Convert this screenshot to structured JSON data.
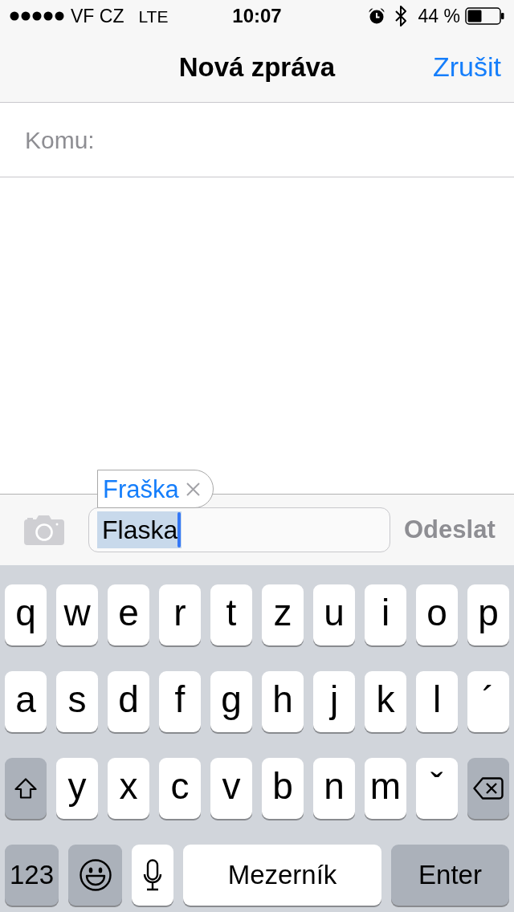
{
  "status_bar": {
    "carrier": "VF CZ",
    "network": "LTE",
    "time": "10:07",
    "battery": "44 %"
  },
  "nav_bar": {
    "title": "Nová zpráva",
    "cancel_button": "Zrušit"
  },
  "recipient": {
    "label": "Komu:"
  },
  "compose": {
    "text": "Flaska",
    "selected": true,
    "send_button": {
      "label": "Odeslat",
      "disabled": true
    },
    "suggestion": {
      "text": "Fraška"
    }
  },
  "keyboard": {
    "letter_rows": [
      [
        {
          "kind": "char",
          "label": "q"
        },
        {
          "kind": "char",
          "label": "w"
        },
        {
          "kind": "char",
          "label": "e"
        },
        {
          "kind": "char",
          "label": "r"
        },
        {
          "kind": "char",
          "label": "t"
        },
        {
          "kind": "char",
          "label": "z"
        },
        {
          "kind": "char",
          "label": "u"
        },
        {
          "kind": "char",
          "label": "i"
        },
        {
          "kind": "char",
          "label": "o"
        },
        {
          "kind": "char",
          "label": "p"
        }
      ],
      [
        {
          "kind": "char",
          "label": "a"
        },
        {
          "kind": "char",
          "label": "s"
        },
        {
          "kind": "char",
          "label": "d"
        },
        {
          "kind": "char",
          "label": "f"
        },
        {
          "kind": "char",
          "label": "g"
        },
        {
          "kind": "char",
          "label": "h"
        },
        {
          "kind": "char",
          "label": "j"
        },
        {
          "kind": "char",
          "label": "k"
        },
        {
          "kind": "char",
          "label": "l"
        },
        {
          "kind": "char",
          "label": "´"
        }
      ],
      [
        {
          "kind": "shift"
        },
        {
          "kind": "char",
          "label": "y"
        },
        {
          "kind": "char",
          "label": "x"
        },
        {
          "kind": "char",
          "label": "c"
        },
        {
          "kind": "char",
          "label": "v"
        },
        {
          "kind": "char",
          "label": "b"
        },
        {
          "kind": "char",
          "label": "n"
        },
        {
          "kind": "char",
          "label": "m"
        },
        {
          "kind": "char",
          "label": "ˇ"
        },
        {
          "kind": "delete"
        }
      ]
    ],
    "bottom_row": [
      {
        "kind": "mode",
        "label": "123"
      },
      {
        "kind": "emoji"
      },
      {
        "kind": "dictation"
      },
      {
        "kind": "space",
        "label": "Mezerník"
      },
      {
        "kind": "return",
        "label": "Enter"
      }
    ]
  }
}
